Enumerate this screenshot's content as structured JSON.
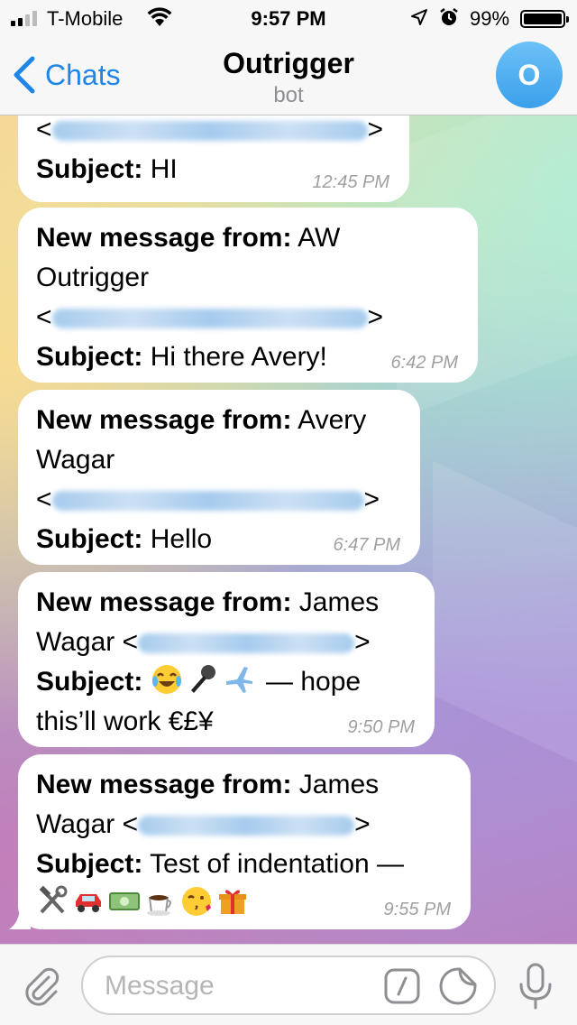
{
  "status_bar": {
    "carrier": "T-Mobile",
    "time": "9:57 PM",
    "battery": "99%"
  },
  "nav": {
    "back_label": "Chats",
    "title": "Outrigger",
    "subtitle": "bot",
    "avatar_letter": "O"
  },
  "messages": [
    {
      "partial": true,
      "label_subject": "Subject:",
      "subject": " HI",
      "time": "12:45 PM"
    },
    {
      "label_from": "New message from:",
      "from_line1": " AW",
      "from_line2": "Outrigger",
      "label_subject": "Subject:",
      "subject": " Hi there Avery!",
      "time": "6:42 PM"
    },
    {
      "label_from": "New message from:",
      "from_line1": " Avery",
      "from_line2": "Wagar",
      "label_subject": "Subject:",
      "subject": " Hello",
      "time": "6:47 PM"
    },
    {
      "label_from": "New message from:",
      "from_line1": " James",
      "from_line2": "Wagar ",
      "label_subject": "Subject:",
      "subject_after_emoji": " — hope",
      "subject_line2": "this’ll work €£¥",
      "emojis": [
        "face-with-tears-of-joy",
        "microphone",
        "airplane"
      ],
      "time": "9:50 PM"
    },
    {
      "label_from": "New message from:",
      "from_line1": " James",
      "from_line2": "Wagar ",
      "label_subject": "Subject:",
      "subject": " Test of indentation —",
      "emojis": [
        "hammer-and-wrench",
        "car",
        "dollar-banknote",
        "hot-beverage",
        "face-blowing-kiss",
        "gift"
      ],
      "time": "9:55 PM"
    }
  ],
  "input": {
    "placeholder": "Message"
  },
  "colors": {
    "accent": "#1f86e8",
    "bubble": "#ffffff",
    "time_text": "#a0a0a0",
    "blurred_email": "#9cc6ec"
  }
}
